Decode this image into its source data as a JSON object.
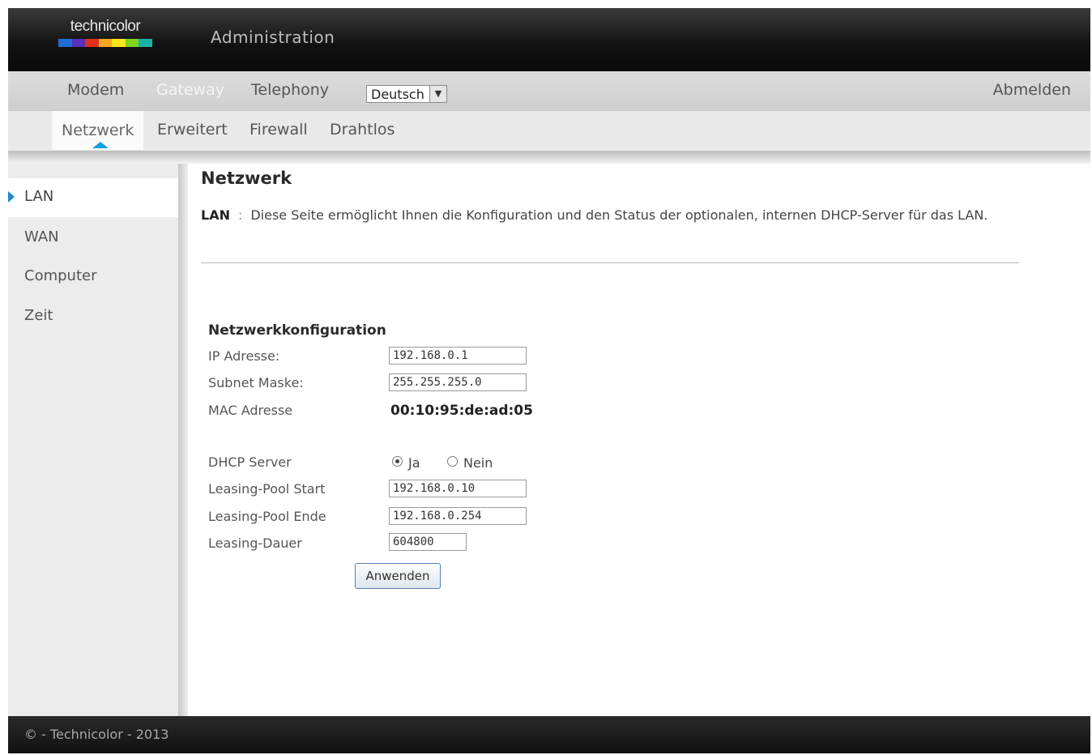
{
  "header": {
    "logo_text": "technicolor",
    "logo_colors": [
      "#1e6fd9",
      "#5b2fb8",
      "#e0301e",
      "#f5a623",
      "#f8e71c",
      "#7ed321",
      "#19b3a6"
    ],
    "title": "Administration"
  },
  "main_nav": {
    "items": [
      {
        "label": "Modem",
        "active": false
      },
      {
        "label": "Gateway",
        "active": true
      },
      {
        "label": "Telephony",
        "active": false
      }
    ],
    "language": "Deutsch",
    "logout": "Abmelden"
  },
  "sub_nav": {
    "items": [
      {
        "label": "Netzwerk",
        "active": true
      },
      {
        "label": "Erweitert",
        "active": false
      },
      {
        "label": "Firewall",
        "active": false
      },
      {
        "label": "Drahtlos",
        "active": false
      }
    ]
  },
  "sidebar": {
    "items": [
      {
        "label": "LAN",
        "active": true
      },
      {
        "label": "WAN",
        "active": false
      },
      {
        "label": "Computer",
        "active": false
      },
      {
        "label": "Zeit",
        "active": false
      }
    ]
  },
  "content": {
    "title": "Netzwerk",
    "desc_key": "LAN",
    "desc_sep": ":",
    "desc_text": "Diese Seite ermöglicht Ihnen die Konfiguration und den Status der optionalen, internen DHCP-Server für das LAN.",
    "section_title": "Netzwerkkonfiguration",
    "fields": {
      "ip_label": "IP Adresse:",
      "ip_value": "192.168.0.1",
      "subnet_label": "Subnet Maske:",
      "subnet_value": "255.255.255.0",
      "mac_label": "MAC Adresse",
      "mac_value": "00:10:95:de:ad:05",
      "dhcp_label": "DHCP Server",
      "dhcp_yes": "Ja",
      "dhcp_no": "Nein",
      "dhcp_selected": "Ja",
      "pool_start_label": "Leasing-Pool Start",
      "pool_start_value": "192.168.0.10",
      "pool_end_label": "Leasing-Pool Ende",
      "pool_end_value": "192.168.0.254",
      "lease_label": "Leasing-Dauer",
      "lease_value": "604800"
    },
    "apply_button": "Anwenden"
  },
  "footer": {
    "text": "© - Technicolor - 2013"
  },
  "colors": {
    "accent": "#1a8ad4",
    "header_bg": "#111111",
    "nav_bg": "#d6d6d6"
  }
}
